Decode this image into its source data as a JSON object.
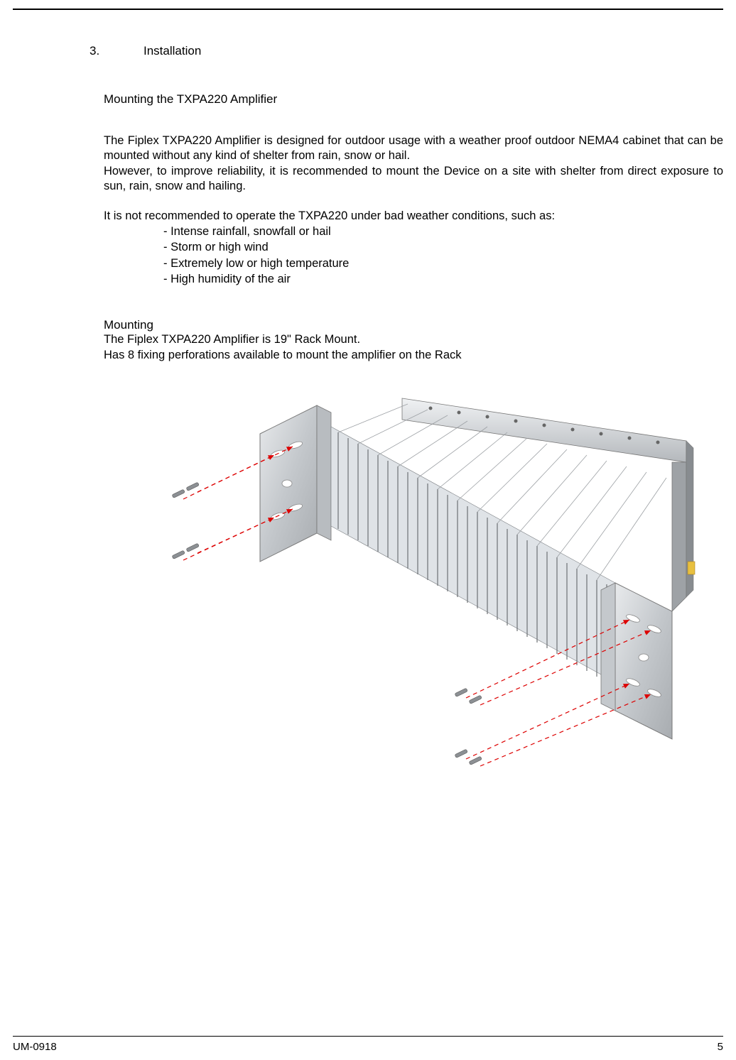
{
  "section": {
    "number": "3.",
    "title": "Installation"
  },
  "sub1": {
    "heading": "Mounting the TXPA220 Amplifier",
    "para1": "The Fiplex TXPA220 Amplifier is designed for outdoor usage with a weather proof outdoor NEMA4 cabinet that can be mounted without any kind of shelter from rain, snow or hail.",
    "para2": "However, to improve reliability, it is recommended to mount the Device on a site with shelter from direct exposure to sun, rain, snow and hailing.",
    "para3": "It is not recommended to operate the TXPA220 under bad weather conditions, such as:",
    "conditions": [
      "- Intense rainfall, snowfall or hail",
      "- Storm or high wind",
      "- Extremely low or high temperature",
      "- High humidity of the air"
    ]
  },
  "sub2": {
    "heading": "Mounting",
    "line1": "The Fiplex TXPA220 Amplifier is 19\" Rack Mount.",
    "line2": "Has 8 fixing perforations available to mount the amplifier on the Rack"
  },
  "footer": {
    "doc_id": "UM-0918",
    "page_num": "5"
  }
}
